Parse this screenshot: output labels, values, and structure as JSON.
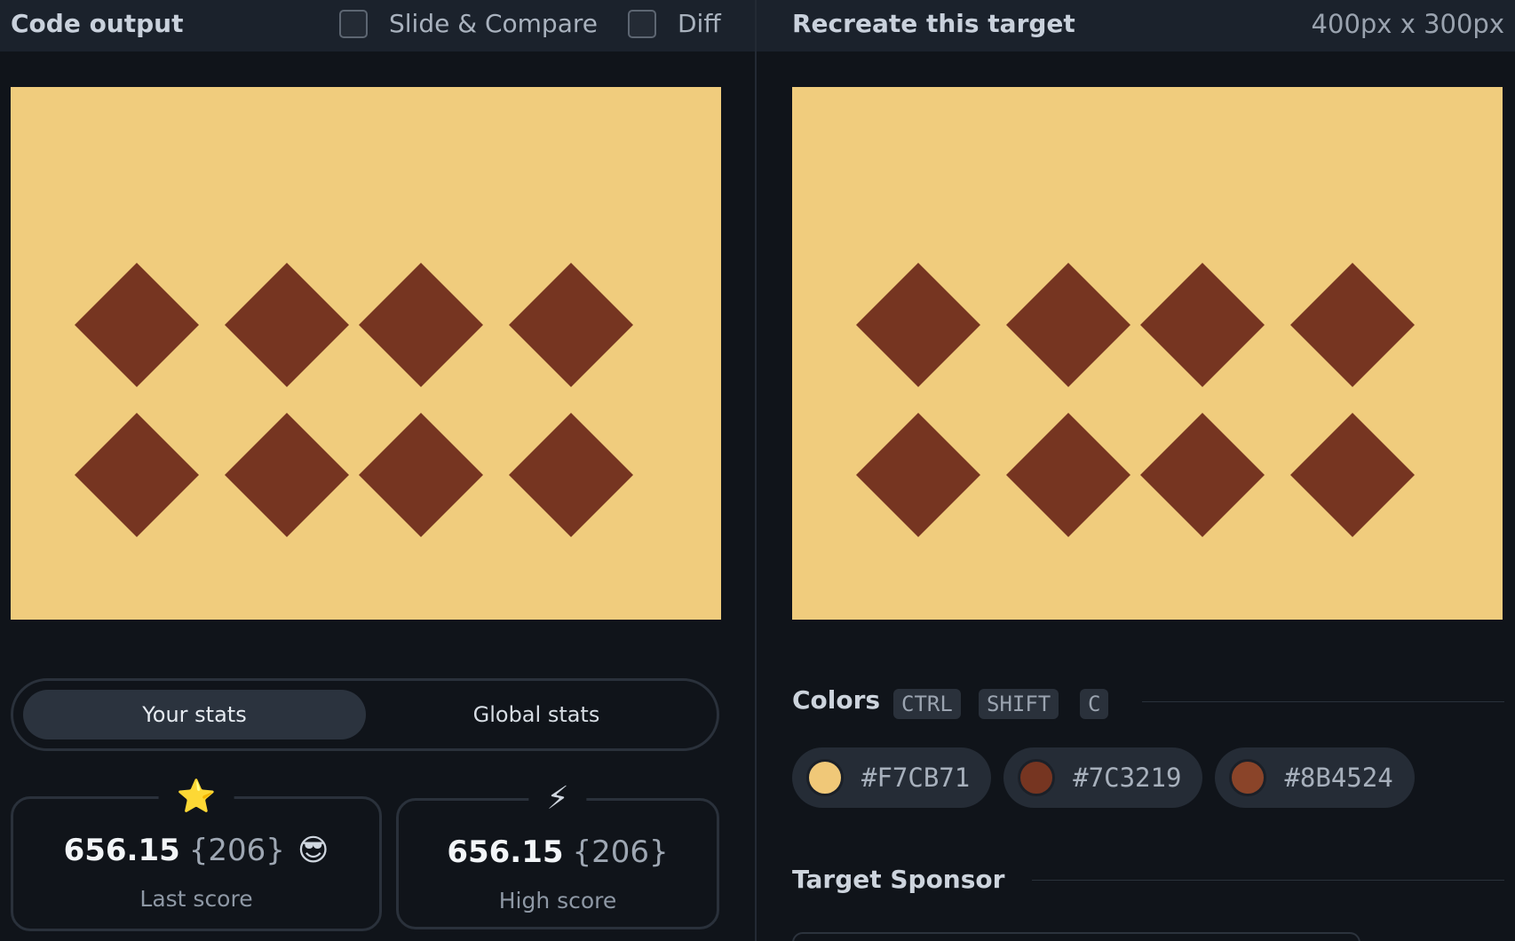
{
  "output_panel": {
    "title": "Code output",
    "slide_compare_label": "Slide & Compare",
    "slide_compare_checked": false,
    "diff_label": "Diff",
    "diff_checked": false
  },
  "target_panel": {
    "title": "Recreate this target",
    "dimensions": "400px x 300px"
  },
  "canvas_colors": {
    "background": "#F0CC7D",
    "shape": "#763521"
  },
  "stats": {
    "tabs": [
      {
        "label": "Your stats",
        "active": true
      },
      {
        "label": "Global stats",
        "active": false
      }
    ],
    "last": {
      "icon": "star-icon",
      "icon_glyph": "⭐",
      "score": "656.15",
      "count": "{206}",
      "emoji": "😎",
      "label": "Last score"
    },
    "high": {
      "icon": "lightning-icon",
      "icon_glyph": "⚡",
      "score": "656.15",
      "count": "{206}",
      "label": "High score"
    }
  },
  "colors": {
    "title": "Colors",
    "shortcut_keys": [
      "CTRL",
      "SHIFT",
      "C"
    ],
    "swatches": [
      {
        "hex": "#F7CB71",
        "swatch": "#F0C878"
      },
      {
        "hex": "#7C3219",
        "swatch": "#763521"
      },
      {
        "hex": "#8B4524",
        "swatch": "#8A4429"
      }
    ]
  },
  "sponsor": {
    "title": "Target Sponsor"
  }
}
